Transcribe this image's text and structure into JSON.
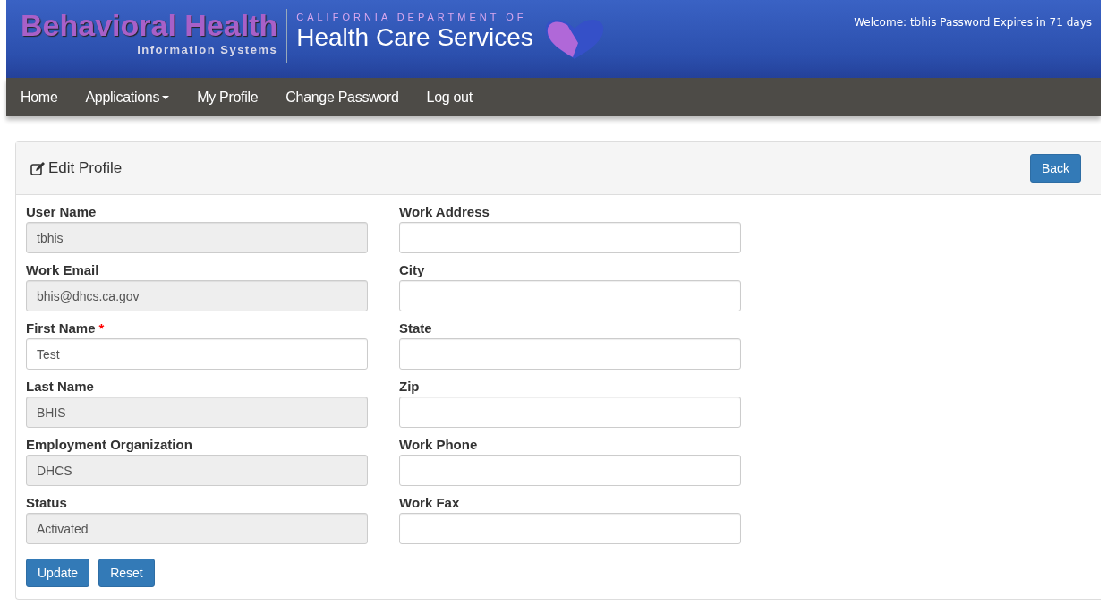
{
  "header": {
    "logo_title": "Behavioral Health",
    "logo_subtitle": "Information Systems",
    "department_line": "CALIFORNIA DEPARTMENT OF",
    "department_name": "Health Care Services",
    "welcome": "Welcome: tbhis Password Expires in 71 days"
  },
  "nav": [
    {
      "label": "Home",
      "dropdown": false
    },
    {
      "label": "Applications",
      "dropdown": true
    },
    {
      "label": "My Profile",
      "dropdown": false
    },
    {
      "label": "Change Password",
      "dropdown": false
    },
    {
      "label": "Log out",
      "dropdown": false
    }
  ],
  "panel": {
    "title": "Edit Profile",
    "back_button": "Back"
  },
  "left_fields": [
    {
      "label": "User Name",
      "value": "tbhis",
      "disabled": true
    },
    {
      "label": "Work Email",
      "value": "bhis@dhcs.ca.gov",
      "disabled": true
    },
    {
      "label": "First Name",
      "value": "Test",
      "required_mark": "*",
      "disabled": false
    },
    {
      "label": "Last Name",
      "value": "BHIS",
      "disabled": true
    },
    {
      "label": "Employment Organization",
      "value": "DHCS",
      "disabled": true
    },
    {
      "label": "Status",
      "value": "Activated",
      "disabled": true
    }
  ],
  "right_fields": [
    {
      "label": "Work Address",
      "disabled": false
    },
    {
      "label": "City",
      "disabled": false
    },
    {
      "label": "State",
      "disabled": false
    },
    {
      "label": "Zip",
      "disabled": false
    },
    {
      "label": "Work Phone",
      "disabled": false
    },
    {
      "label": "Work Fax",
      "disabled": false
    }
  ],
  "buttons": [
    "Update",
    "Reset"
  ]
}
